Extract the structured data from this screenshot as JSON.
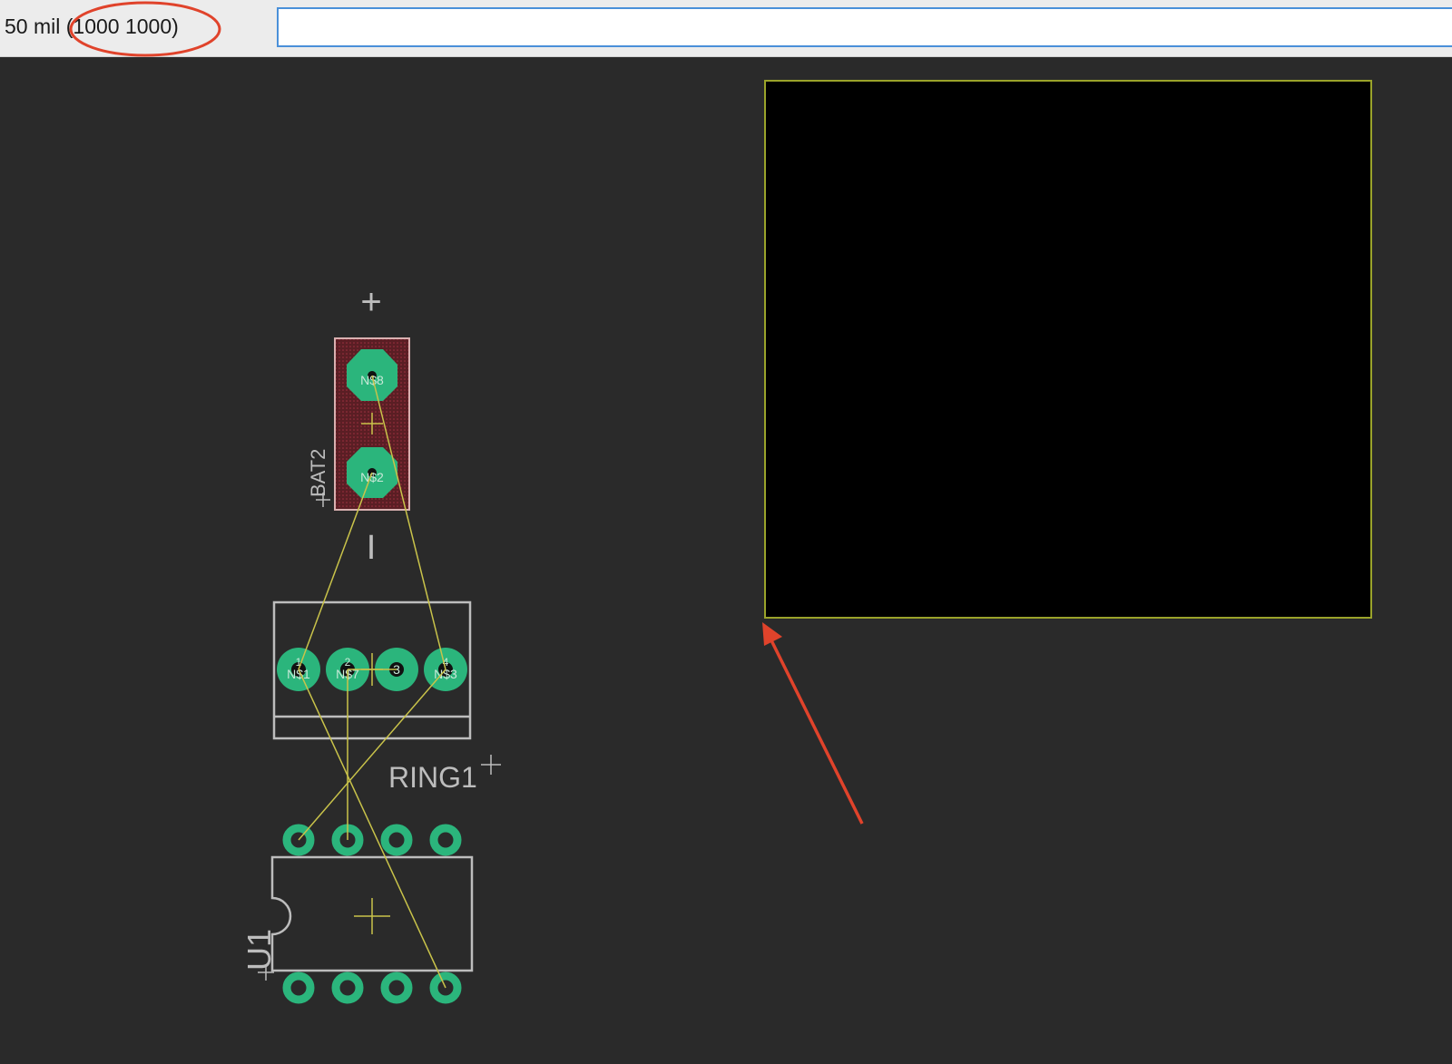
{
  "toolbar": {
    "grid_size": "50 mil",
    "coordinates": "(1000 1000)",
    "command_placeholder": ""
  },
  "board": {
    "outline_color": "#9aa32a",
    "fill_color": "#000000"
  },
  "parts": {
    "bat2": {
      "name": "BAT2",
      "plus_marker": "+",
      "minus_marker": "I",
      "pad_labels": [
        "N$8",
        "N$2"
      ]
    },
    "ring1": {
      "name": "RING1",
      "pin_numbers": [
        "1",
        "2",
        "3",
        "4"
      ],
      "pad_labels": [
        "N$1",
        "N$7",
        "",
        "N$3"
      ]
    },
    "u1": {
      "name": "U1"
    }
  },
  "colors": {
    "canvas": "#2a2a2a",
    "pad": "#2bb57c",
    "airwire": "#c9c34a",
    "silkscreen": "#bdbdbd",
    "annotation": "#e0432b",
    "origin_cross": "#c9c34a"
  }
}
